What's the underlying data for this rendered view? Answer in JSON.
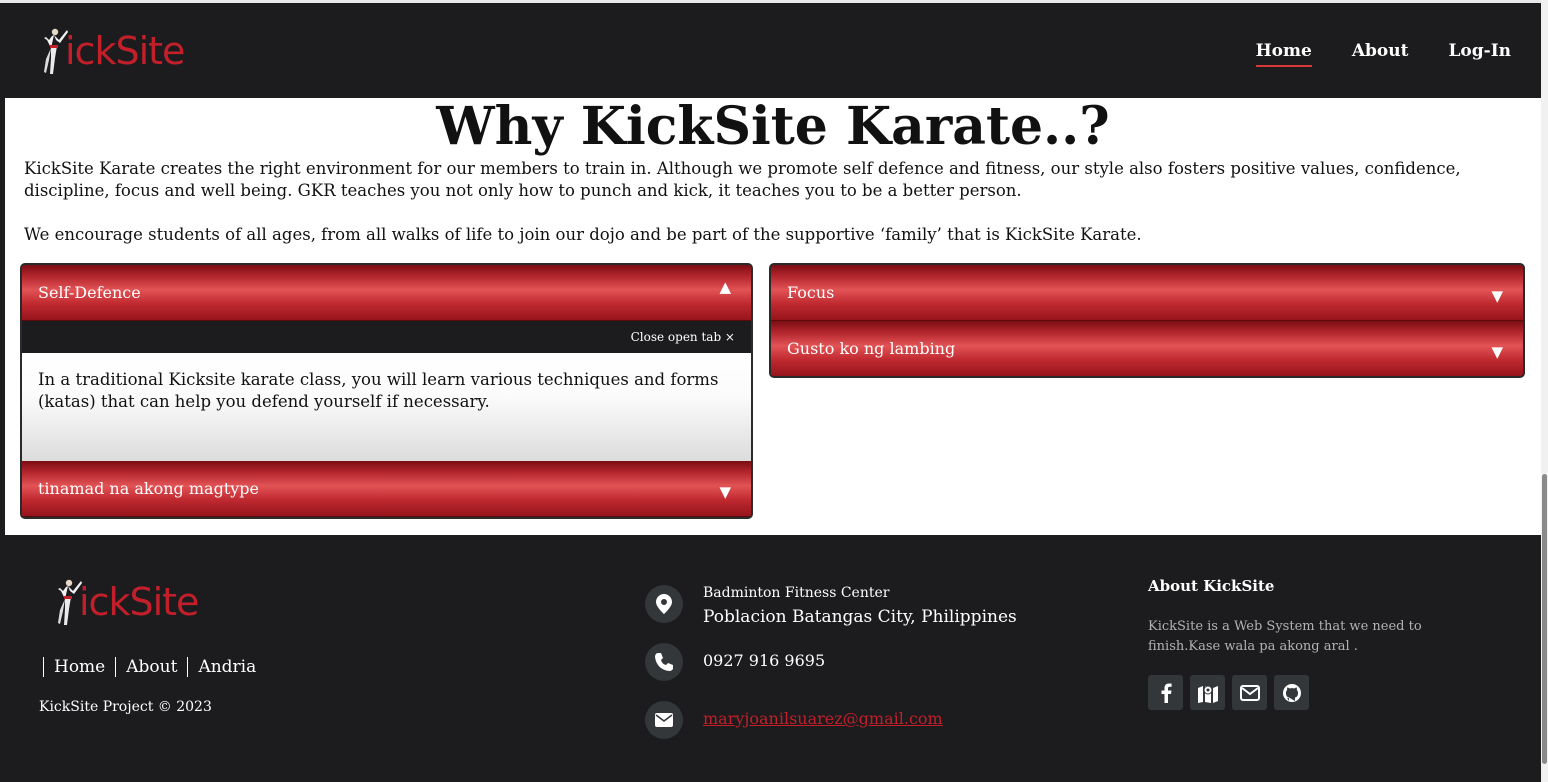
{
  "header": {
    "logo_text": "ickSite",
    "nav": [
      {
        "label": "Home",
        "active": true
      },
      {
        "label": "About"
      },
      {
        "label": "Log-In"
      }
    ]
  },
  "main": {
    "title": "Why KickSite Karate..?",
    "paragraph1": "KickSite Karate creates the right environment for our members to train in. Although we promote self defence and fitness, our style also fosters positive values, confidence, discipline, focus and well being. GKR teaches you not only how to punch and kick, it teaches you to be a better person.",
    "paragraph2": "We encourage students of all ages, from all walks of life to join our dojo and be part of the supportive ‘family’ that is KickSite Karate.",
    "left_accordion": {
      "tab1_label": "Self-Defence",
      "close_label": "Close open tab ×",
      "tab1_body": "In a traditional Kicksite karate class, you will learn various techniques and forms (katas) that can help you defend yourself if necessary.",
      "tab2_label": "tinamad na akong magtype"
    },
    "right_accordion": {
      "tab1_label": "Focus",
      "tab2_label": "Gusto ko ng lambing"
    },
    "arrow_up": "▲",
    "arrow_down": "▼"
  },
  "footer": {
    "logo_text": "ickSite",
    "links": [
      "Home",
      "About",
      "Andria"
    ],
    "copyright": "KickSite Project © 2023",
    "location_line1": "Badminton Fitness Center",
    "location_line2": "Poblacion Batangas City, Philippines",
    "phone": "0927 916 9695",
    "email": "maryjoanilsuarez@gmail.com",
    "about_title": "About KickSite",
    "about_text": "KickSite is a Web System that we need to finish.Kase wala pa akong aral ."
  },
  "colors": {
    "brand_red": "#c21f2a",
    "dark_bg": "#1c1c1e",
    "accordion_red": "#c02a30"
  },
  "icons": [
    "karate-figure-icon",
    "map-pin-icon",
    "phone-icon",
    "envelope-icon",
    "facebook-icon",
    "map-icon",
    "mail-icon",
    "github-icon"
  ]
}
